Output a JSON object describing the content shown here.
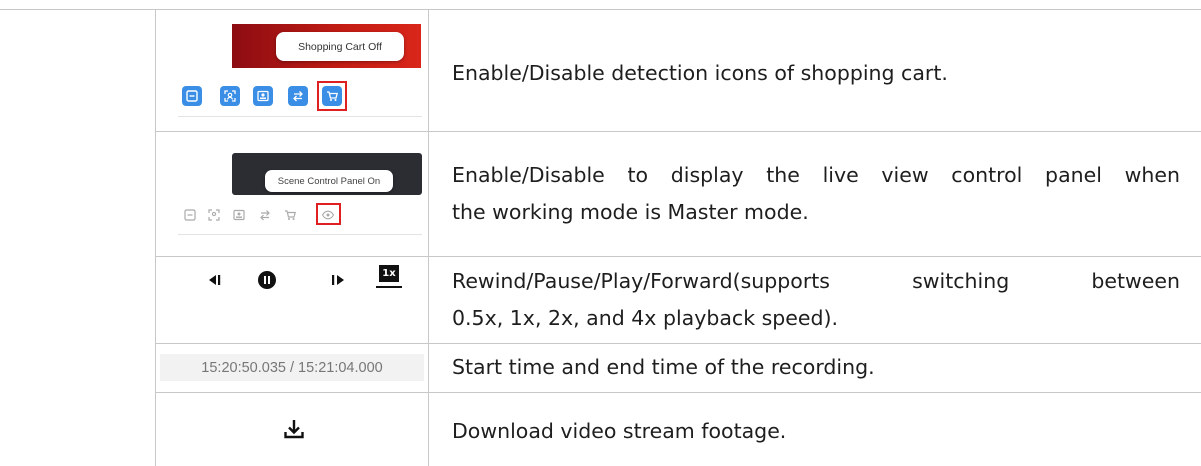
{
  "rows": [
    {
      "tooltip": "Shopping Cart Off",
      "description": "Enable/Disable detection icons of shopping cart.",
      "icons": [
        "region-icon",
        "person-detect-icon",
        "face-id-icon",
        "swap-arrows-icon",
        "shopping-cart-icon"
      ]
    },
    {
      "tooltip": "Scene Control Panel On",
      "description_line1": "Enable/Disable to display the live view control panel when",
      "description_line2": "the working mode is Master mode.",
      "icons": [
        "region-icon",
        "person-detect-icon",
        "face-id-icon",
        "swap-arrows-icon",
        "shopping-cart-icon",
        "eye-icon"
      ]
    },
    {
      "speed_label": "1x",
      "description_line1": "Rewind/Pause/Play/Forward(supports switching between",
      "description_line2": "0.5x, 1x, 2x, and 4x playback speed).",
      "icons": [
        "rewind-icon",
        "pause-icon",
        "play-icon",
        "speed-icon"
      ]
    },
    {
      "time_range": "15:20:50.035 / 15:21:04.000",
      "description": "Start time and end time of the recording."
    },
    {
      "description": "Download video stream footage.",
      "icons": [
        "download-icon"
      ]
    }
  ],
  "colors": {
    "accent_blue": "#3a8ee6",
    "highlight_red": "#e02020",
    "tooltip_banner_red": "#c41d14",
    "tooltip_banner_dark": "#2b2d33",
    "grid_line": "#c8c8c8"
  }
}
